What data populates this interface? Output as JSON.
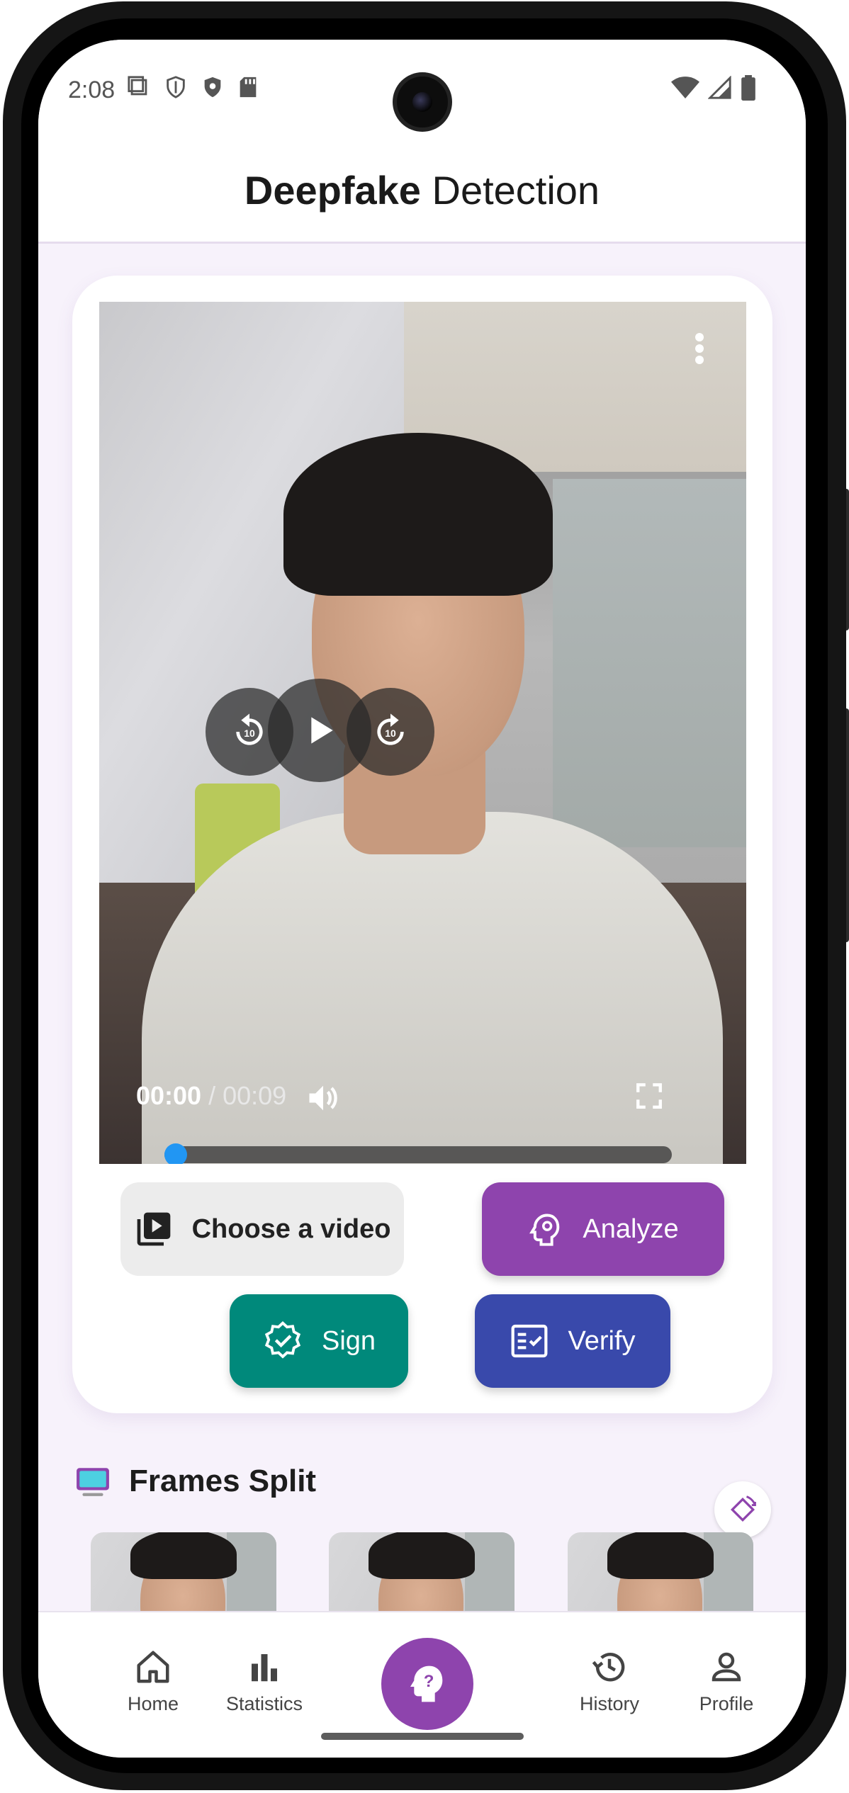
{
  "status_bar": {
    "time": "2:08",
    "left_icons": [
      "screenshot-icon",
      "shield-outline-icon",
      "shield-filled-icon",
      "sd-card-icon"
    ],
    "right_icons": [
      "wifi-icon",
      "cellular-icon",
      "battery-icon"
    ]
  },
  "app_bar": {
    "title_bold": "Deepfake",
    "title_regular": " Detection"
  },
  "video_player": {
    "current_time": "00:00",
    "separator": " / ",
    "total_time": "00:09",
    "progress": 0.0,
    "controls": [
      "rewind-10-icon",
      "play-icon",
      "forward-10-icon",
      "volume-icon",
      "fullscreen-icon",
      "more-vert-icon"
    ]
  },
  "actions": {
    "choose_label": "Choose a video",
    "analyze_label": "Analyze",
    "sign_label": "Sign",
    "verify_label": "Verify"
  },
  "frames_section": {
    "title": "Frames Split",
    "thumbnail_count": 3
  },
  "bottom_nav": {
    "items": [
      {
        "label": "Home",
        "icon": "home-icon"
      },
      {
        "label": "Statistics",
        "icon": "bar-chart-icon"
      },
      {
        "label": "",
        "icon": "head-question-icon"
      },
      {
        "label": "History",
        "icon": "history-icon"
      },
      {
        "label": "Profile",
        "icon": "person-icon"
      }
    ]
  },
  "colors": {
    "analyze": "#8e44ad",
    "sign": "#00897b",
    "verify": "#3949ab",
    "seek_thumb": "#2196f3",
    "nav_center": "#8e44ad"
  }
}
